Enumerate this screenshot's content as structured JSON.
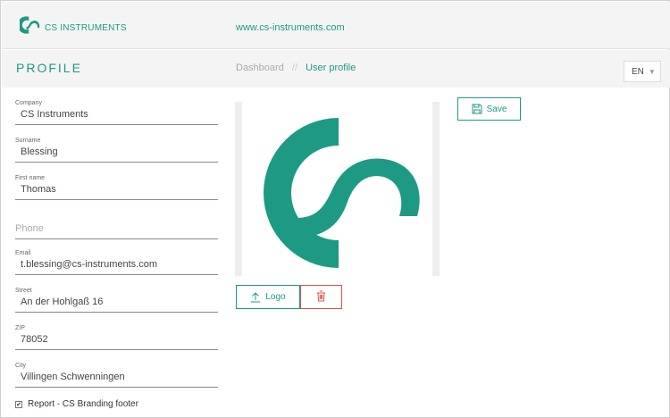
{
  "app": {
    "brand": "CS INSTRUMENTS",
    "site_link": "www.cs-instruments.com"
  },
  "header": {
    "title": "PROFILE",
    "breadcrumb": [
      "Dashboard",
      "User profile"
    ],
    "breadcrumb_separator": "//",
    "language": "EN"
  },
  "form": {
    "company": {
      "label": "Company",
      "value": "CS Instruments"
    },
    "surname": {
      "label": "Surname",
      "value": "Blessing"
    },
    "first_name": {
      "label": "First name",
      "value": "Thomas"
    },
    "phone": {
      "placeholder": "Phone",
      "value": ""
    },
    "email": {
      "label": "Email",
      "value": "t.blessing@cs-instruments.com"
    },
    "street": {
      "label": "Street",
      "value": "An der Hohlgaß 16"
    },
    "zip": {
      "label": "ZIP",
      "value": "78052"
    },
    "city": {
      "label": "City",
      "value": "Villingen Schwenningen"
    },
    "report_branding": {
      "label": "Report - CS Branding footer",
      "checked": true
    }
  },
  "actions": {
    "save_label": "Save",
    "logo_label": "Logo"
  },
  "colors": {
    "accent": "#1e9a84",
    "danger": "#d9534f"
  },
  "icons": [
    "cs-logo-icon",
    "chevron-down-icon",
    "save-icon",
    "upload-icon",
    "trash-icon",
    "checkbox-checked-icon"
  ]
}
